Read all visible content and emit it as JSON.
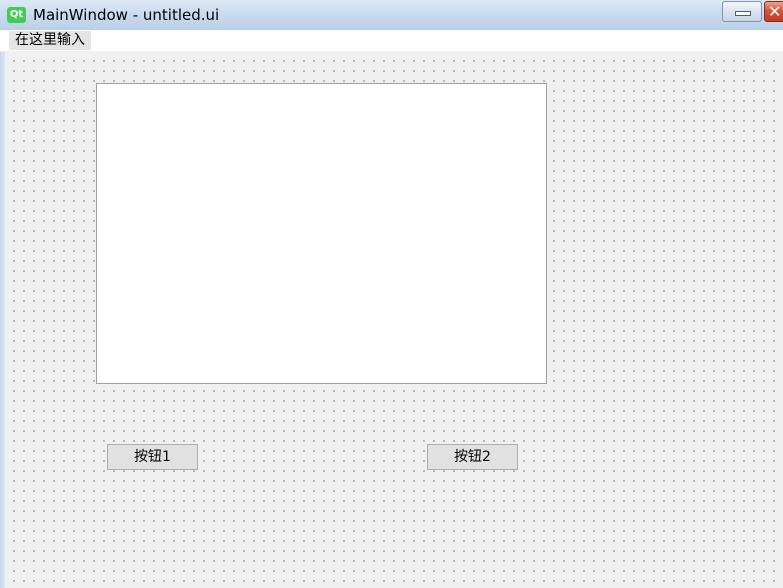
{
  "window": {
    "title": "MainWindow - untitled.ui",
    "icon": "qt-logo-icon",
    "icon_text": "Qt",
    "icon_color": "#41cd52",
    "controls": {
      "minimize_icon": "minimize-icon",
      "close_icon": "close-icon",
      "close_glyph": "✕"
    }
  },
  "menu_bar": {
    "items": [
      {
        "label": "在这里输入"
      }
    ]
  },
  "central_widget": {
    "text_edit": {
      "value": ""
    },
    "buttons": [
      {
        "label": "按钮1"
      },
      {
        "label": "按钮2"
      }
    ]
  }
}
